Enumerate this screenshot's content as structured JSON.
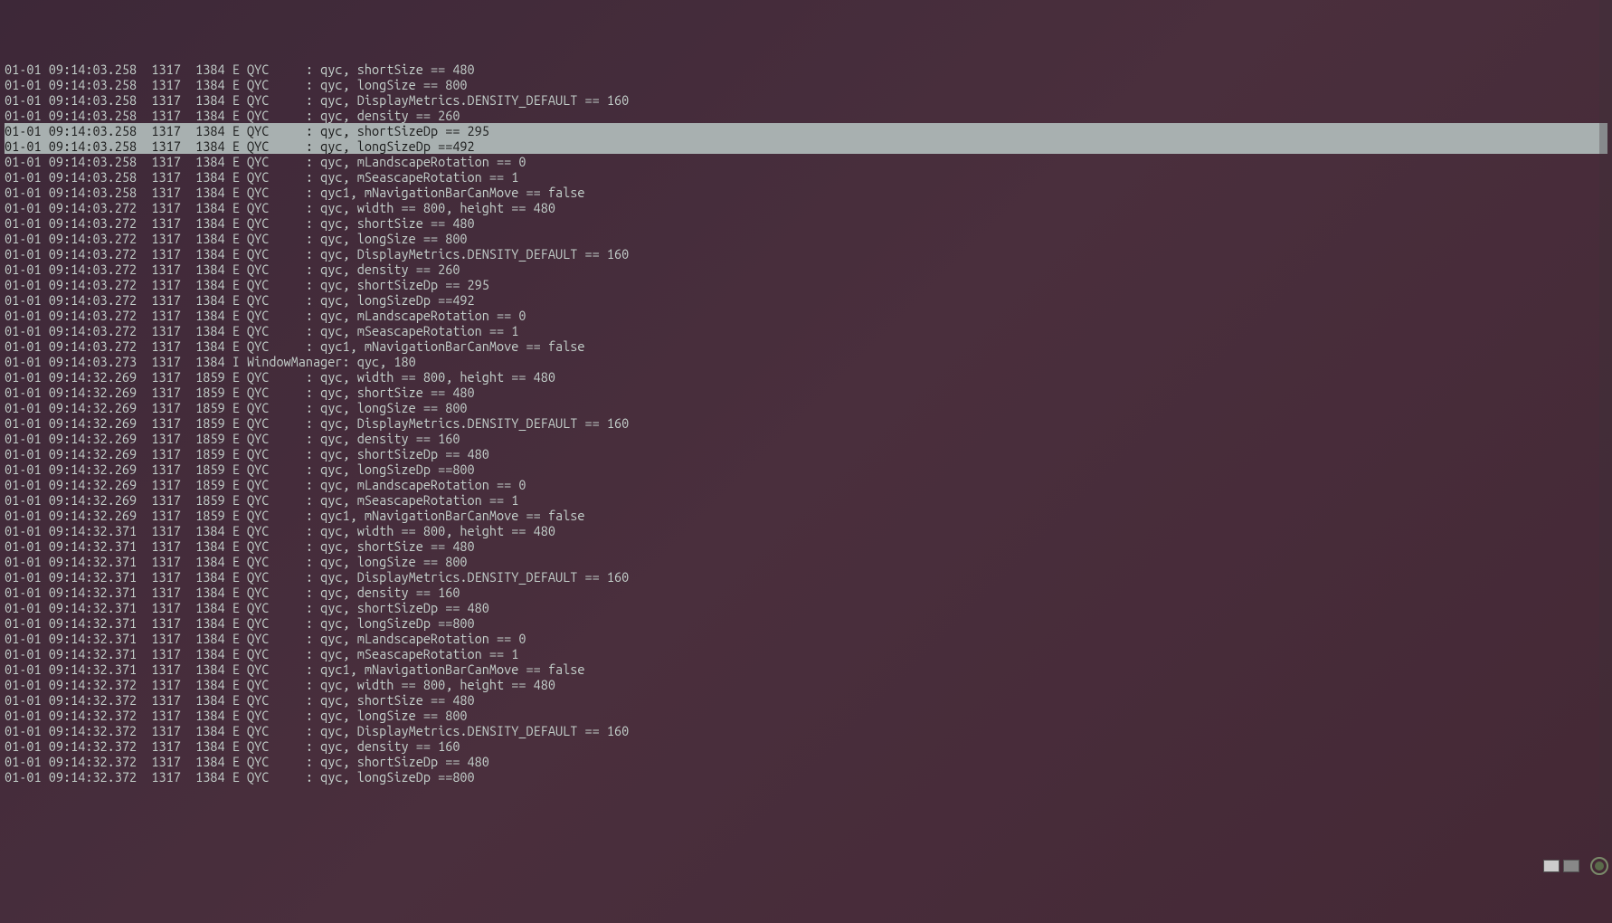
{
  "lines": [
    {
      "text": "01-01 09:14:03.258  1317  1384 E QYC     : qyc, shortSize == 480",
      "hl": false
    },
    {
      "text": "01-01 09:14:03.258  1317  1384 E QYC     : qyc, longSize == 800",
      "hl": false
    },
    {
      "text": "01-01 09:14:03.258  1317  1384 E QYC     : qyc, DisplayMetrics.DENSITY_DEFAULT == 160",
      "hl": false
    },
    {
      "text": "01-01 09:14:03.258  1317  1384 E QYC     : qyc, density == 260",
      "hl": false
    },
    {
      "text": "01-01 09:14:03.258  1317  1384 E QYC     : qyc, shortSizeDp == 295",
      "hl": true
    },
    {
      "text": "01-01 09:14:03.258  1317  1384 E QYC     : qyc, longSizeDp ==492",
      "hl": true
    },
    {
      "text": "01-01 09:14:03.258  1317  1384 E QYC     : qyc, mLandscapeRotation == 0",
      "hl": false
    },
    {
      "text": "01-01 09:14:03.258  1317  1384 E QYC     : qyc, mSeascapeRotation == 1",
      "hl": false
    },
    {
      "text": "01-01 09:14:03.258  1317  1384 E QYC     : qyc1, mNavigationBarCanMove == false",
      "hl": false
    },
    {
      "text": "01-01 09:14:03.272  1317  1384 E QYC     : qyc, width == 800, height == 480",
      "hl": false
    },
    {
      "text": "01-01 09:14:03.272  1317  1384 E QYC     : qyc, shortSize == 480",
      "hl": false
    },
    {
      "text": "01-01 09:14:03.272  1317  1384 E QYC     : qyc, longSize == 800",
      "hl": false
    },
    {
      "text": "01-01 09:14:03.272  1317  1384 E QYC     : qyc, DisplayMetrics.DENSITY_DEFAULT == 160",
      "hl": false
    },
    {
      "text": "01-01 09:14:03.272  1317  1384 E QYC     : qyc, density == 260",
      "hl": false
    },
    {
      "text": "01-01 09:14:03.272  1317  1384 E QYC     : qyc, shortSizeDp == 295",
      "hl": false
    },
    {
      "text": "01-01 09:14:03.272  1317  1384 E QYC     : qyc, longSizeDp ==492",
      "hl": false
    },
    {
      "text": "01-01 09:14:03.272  1317  1384 E QYC     : qyc, mLandscapeRotation == 0",
      "hl": false
    },
    {
      "text": "01-01 09:14:03.272  1317  1384 E QYC     : qyc, mSeascapeRotation == 1",
      "hl": false
    },
    {
      "text": "01-01 09:14:03.272  1317  1384 E QYC     : qyc1, mNavigationBarCanMove == false",
      "hl": false
    },
    {
      "text": "01-01 09:14:03.273  1317  1384 I WindowManager: qyc, 180",
      "hl": false
    },
    {
      "text": "01-01 09:14:32.269  1317  1859 E QYC     : qyc, width == 800, height == 480",
      "hl": false
    },
    {
      "text": "01-01 09:14:32.269  1317  1859 E QYC     : qyc, shortSize == 480",
      "hl": false
    },
    {
      "text": "01-01 09:14:32.269  1317  1859 E QYC     : qyc, longSize == 800",
      "hl": false
    },
    {
      "text": "01-01 09:14:32.269  1317  1859 E QYC     : qyc, DisplayMetrics.DENSITY_DEFAULT == 160",
      "hl": false
    },
    {
      "text": "01-01 09:14:32.269  1317  1859 E QYC     : qyc, density == 160",
      "hl": false
    },
    {
      "text": "01-01 09:14:32.269  1317  1859 E QYC     : qyc, shortSizeDp == 480",
      "hl": false
    },
    {
      "text": "01-01 09:14:32.269  1317  1859 E QYC     : qyc, longSizeDp ==800",
      "hl": false
    },
    {
      "text": "01-01 09:14:32.269  1317  1859 E QYC     : qyc, mLandscapeRotation == 0",
      "hl": false
    },
    {
      "text": "01-01 09:14:32.269  1317  1859 E QYC     : qyc, mSeascapeRotation == 1",
      "hl": false
    },
    {
      "text": "01-01 09:14:32.269  1317  1859 E QYC     : qyc1, mNavigationBarCanMove == false",
      "hl": false
    },
    {
      "text": "01-01 09:14:32.371  1317  1384 E QYC     : qyc, width == 800, height == 480",
      "hl": false
    },
    {
      "text": "01-01 09:14:32.371  1317  1384 E QYC     : qyc, shortSize == 480",
      "hl": false
    },
    {
      "text": "01-01 09:14:32.371  1317  1384 E QYC     : qyc, longSize == 800",
      "hl": false
    },
    {
      "text": "01-01 09:14:32.371  1317  1384 E QYC     : qyc, DisplayMetrics.DENSITY_DEFAULT == 160",
      "hl": false
    },
    {
      "text": "01-01 09:14:32.371  1317  1384 E QYC     : qyc, density == 160",
      "hl": false
    },
    {
      "text": "01-01 09:14:32.371  1317  1384 E QYC     : qyc, shortSizeDp == 480",
      "hl": false
    },
    {
      "text": "01-01 09:14:32.371  1317  1384 E QYC     : qyc, longSizeDp ==800",
      "hl": false
    },
    {
      "text": "01-01 09:14:32.371  1317  1384 E QYC     : qyc, mLandscapeRotation == 0",
      "hl": false
    },
    {
      "text": "01-01 09:14:32.371  1317  1384 E QYC     : qyc, mSeascapeRotation == 1",
      "hl": false
    },
    {
      "text": "01-01 09:14:32.371  1317  1384 E QYC     : qyc1, mNavigationBarCanMove == false",
      "hl": false
    },
    {
      "text": "01-01 09:14:32.372  1317  1384 E QYC     : qyc, width == 800, height == 480",
      "hl": false
    },
    {
      "text": "01-01 09:14:32.372  1317  1384 E QYC     : qyc, shortSize == 480",
      "hl": false
    },
    {
      "text": "01-01 09:14:32.372  1317  1384 E QYC     : qyc, longSize == 800",
      "hl": false
    },
    {
      "text": "01-01 09:14:32.372  1317  1384 E QYC     : qyc, DisplayMetrics.DENSITY_DEFAULT == 160",
      "hl": false
    },
    {
      "text": "01-01 09:14:32.372  1317  1384 E QYC     : qyc, density == 160",
      "hl": false
    },
    {
      "text": "01-01 09:14:32.372  1317  1384 E QYC     : qyc, shortSizeDp == 480",
      "hl": false
    },
    {
      "text": "01-01 09:14:32.372  1317  1384 E QYC     : qyc, longSizeDp ==800",
      "hl": false
    }
  ]
}
